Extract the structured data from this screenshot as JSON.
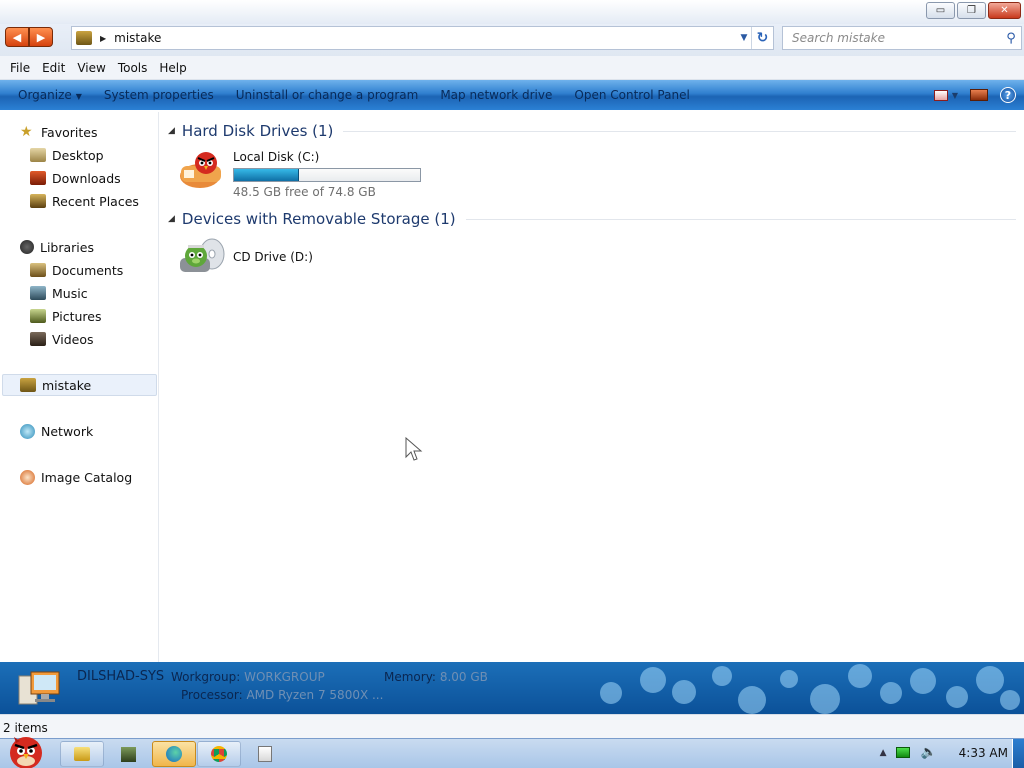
{
  "window": {
    "minimize_icon": "minimize-icon",
    "restore_icon": "restore-icon",
    "close_icon": "close-icon",
    "minimize_glyph": "▭",
    "restore_glyph": "❐",
    "close_glyph": "✕"
  },
  "address": {
    "back_glyph": "◀",
    "forward_glyph": "▶",
    "separator_glyph": "▶",
    "path": "mistake",
    "dropdown_glyph": "▼",
    "refresh_glyph": "↻",
    "search_placeholder": "Search mistake",
    "search_glyph": "⚲"
  },
  "menu": [
    "File",
    "Edit",
    "View",
    "Tools",
    "Help"
  ],
  "commands": {
    "organize": "Organize",
    "organize_dd": "▼",
    "system_properties": "System properties",
    "uninstall": "Uninstall or change a program",
    "map_drive": "Map network drive",
    "control_panel": "Open Control Panel",
    "view_dd": "▼",
    "help_glyph": "?"
  },
  "nav": {
    "favorites": "Favorites",
    "desktop": "Desktop",
    "downloads": "Downloads",
    "recent": "Recent Places",
    "libraries": "Libraries",
    "documents": "Documents",
    "music": "Music",
    "pictures": "Pictures",
    "videos": "Videos",
    "computer": "mistake",
    "network": "Network",
    "image_catalog": "Image Catalog"
  },
  "groups": {
    "hdd_header": "Hard Disk Drives (1)",
    "removable_header": "Devices with Removable Storage (1)",
    "collapse_glyph": "◢"
  },
  "drives": {
    "c_name": "Local Disk (C:)",
    "c_info": "48.5 GB free of 74.8 GB",
    "c_used_fraction": 0.352,
    "d_name": "CD Drive (D:)"
  },
  "details": {
    "computer_name": "DILSHAD-SYS",
    "workgroup_label": "Workgroup:",
    "workgroup_value": "WORKGROUP",
    "memory_label": "Memory:",
    "memory_value": "8.00 GB",
    "processor_label": "Processor:",
    "processor_value": "AMD Ryzen 7 5800X ..."
  },
  "status": {
    "items": "2 items"
  },
  "taskbar": {
    "clock": "4:33 AM",
    "tray_up_glyph": "▲",
    "volume_glyph": "🔈"
  },
  "colors": {
    "accent": "#1e3a6e",
    "command_bar": "#2f7fcf",
    "details_pane": "#0b5199",
    "drive_fill": "#1b8fc8"
  }
}
